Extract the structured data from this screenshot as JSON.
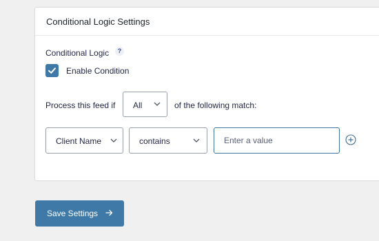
{
  "panel": {
    "title": "Conditional Logic Settings",
    "conditional_logic_label": "Conditional Logic",
    "help_icon": "?",
    "enable_checkbox": {
      "label": "Enable Condition",
      "checked": true
    },
    "process_prefix": "Process this feed if",
    "match_select": {
      "value": "All"
    },
    "process_suffix": "of the following match:",
    "rule": {
      "field_select": {
        "value": "Client Name"
      },
      "operator_select": {
        "value": "contains"
      },
      "value_input": {
        "value": "",
        "placeholder": "Enter a value"
      }
    },
    "add_rule_icon": "plus-circle-icon"
  },
  "save_button": {
    "label": "Save Settings",
    "icon": "arrow-right-icon"
  },
  "colors": {
    "accent": "#3f79a8",
    "background": "#f0f0f1",
    "panel": "#ffffff"
  }
}
